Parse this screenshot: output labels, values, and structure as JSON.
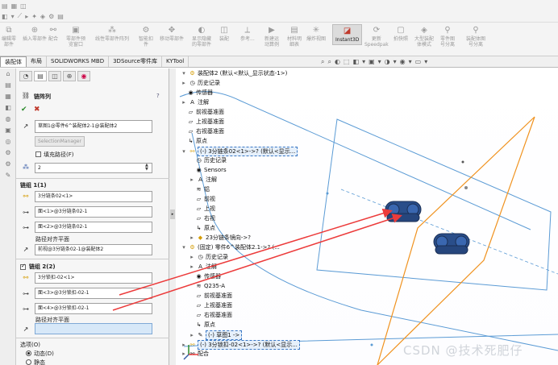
{
  "toolbar": {
    "row1": [
      "◧",
      "▾",
      "⟋",
      "▸",
      "✦",
      "◈",
      "⚙",
      "▤"
    ]
  },
  "ribbon": [
    {
      "l1": "编辑零",
      "l2": "部件"
    },
    {
      "l1": "插入零部件",
      "l2": ""
    },
    {
      "l1": "配合",
      "l2": ""
    },
    {
      "l1": "零部件预",
      "l2": "览窗口"
    },
    {
      "l1": "线性零部件阵列",
      "l2": ""
    },
    {
      "l1": "智能扣",
      "l2": "件"
    },
    {
      "l1": "移动零部件",
      "l2": ""
    },
    {
      "l1": "显示隐藏",
      "l2": "的零部件"
    },
    {
      "l1": "装配",
      "l2": ""
    },
    {
      "l1": "参考...",
      "l2": ""
    },
    {
      "l1": "新建运",
      "l2": "动算例"
    },
    {
      "l1": "材料明",
      "l2": "细表"
    },
    {
      "l1": "爆炸视图",
      "l2": ""
    },
    {
      "l1": "Instant3D",
      "l2": ""
    },
    {
      "l1": "更新",
      "l2": "Speedpak"
    },
    {
      "l1": "拍快照",
      "l2": ""
    },
    {
      "l1": "大型装配",
      "l2": "体模式"
    },
    {
      "l1": "零件图",
      "l2": "号分离"
    },
    {
      "l1": "装配体图",
      "l2": "号分离"
    }
  ],
  "tabs": [
    "装配体",
    "布局",
    "SOLIDWORKS MBD",
    "3DSource零件库",
    "KYTool"
  ],
  "view_icons": [
    "⌕",
    "⌕",
    "◐",
    "⬚",
    "◧",
    "▾",
    "▣",
    "▾",
    "◑",
    "▾",
    "◉",
    "▾",
    "▭",
    "▾"
  ],
  "pm": {
    "title": "链阵列",
    "help": "?",
    "ok": "✔",
    "cancel": "✖",
    "path_value": "草图1@零件6^装配体2-1@装配体2",
    "selection_manager": "SelectionManager",
    "fill_path": "填充路径(F)",
    "count": "2",
    "group1": {
      "title": "链组 1(1)",
      "pin": "3分链条02<1>",
      "pf1": "面<1>@3分链条02-1",
      "pf2": "面<2>@3分链条02-1",
      "align": "路径对齐平面",
      "plane": "前视@3分链条02-1@装配体2"
    },
    "group2": {
      "title": "链组 2(2)",
      "pin": "3分锁扣-02<1>",
      "pf1": "面<3>@3分锁扣-02-1",
      "pf2": "面<4>@3分锁扣-02-1",
      "align": "路径对齐平面",
      "plane": ""
    },
    "options": {
      "title": "选项(O)",
      "dynamic": "动态(D)",
      "other": "静态"
    }
  },
  "tree": [
    {
      "t": "装配体2 (默认<默认_显示状态-1>)"
    },
    {
      "t": "历史记录"
    },
    {
      "t": "传感器"
    },
    {
      "t": "注解"
    },
    {
      "t": "前视基准面"
    },
    {
      "t": "上视基准面"
    },
    {
      "t": "右视基准面"
    },
    {
      "t": "原点"
    },
    {
      "t": "(-) 3分链条02<1>->? (默认<显示..."
    },
    {
      "t": "历史记录"
    },
    {
      "t": "Sensors"
    },
    {
      "t": "注解"
    },
    {
      "t": "铝"
    },
    {
      "t": "前视"
    },
    {
      "t": "上视"
    },
    {
      "t": "右视"
    },
    {
      "t": "原点"
    },
    {
      "t": "23分链条镜向->?"
    },
    {
      "t": "(固定) 零件6^装配体2.1->? (..."
    },
    {
      "t": "历史记录"
    },
    {
      "t": "注解"
    },
    {
      "t": "传感器"
    },
    {
      "t": "Q235-A"
    },
    {
      "t": "前视基准面"
    },
    {
      "t": "上视基准面"
    },
    {
      "t": "右视基准面"
    },
    {
      "t": "原点"
    },
    {
      "t": "(-) 草图1 ->"
    },
    {
      "t": "(-) 3分锁扣-02<1>->? (默认<显示..."
    },
    {
      "t": "配合"
    }
  ],
  "watermark": "CSDN @技术死肥仔"
}
